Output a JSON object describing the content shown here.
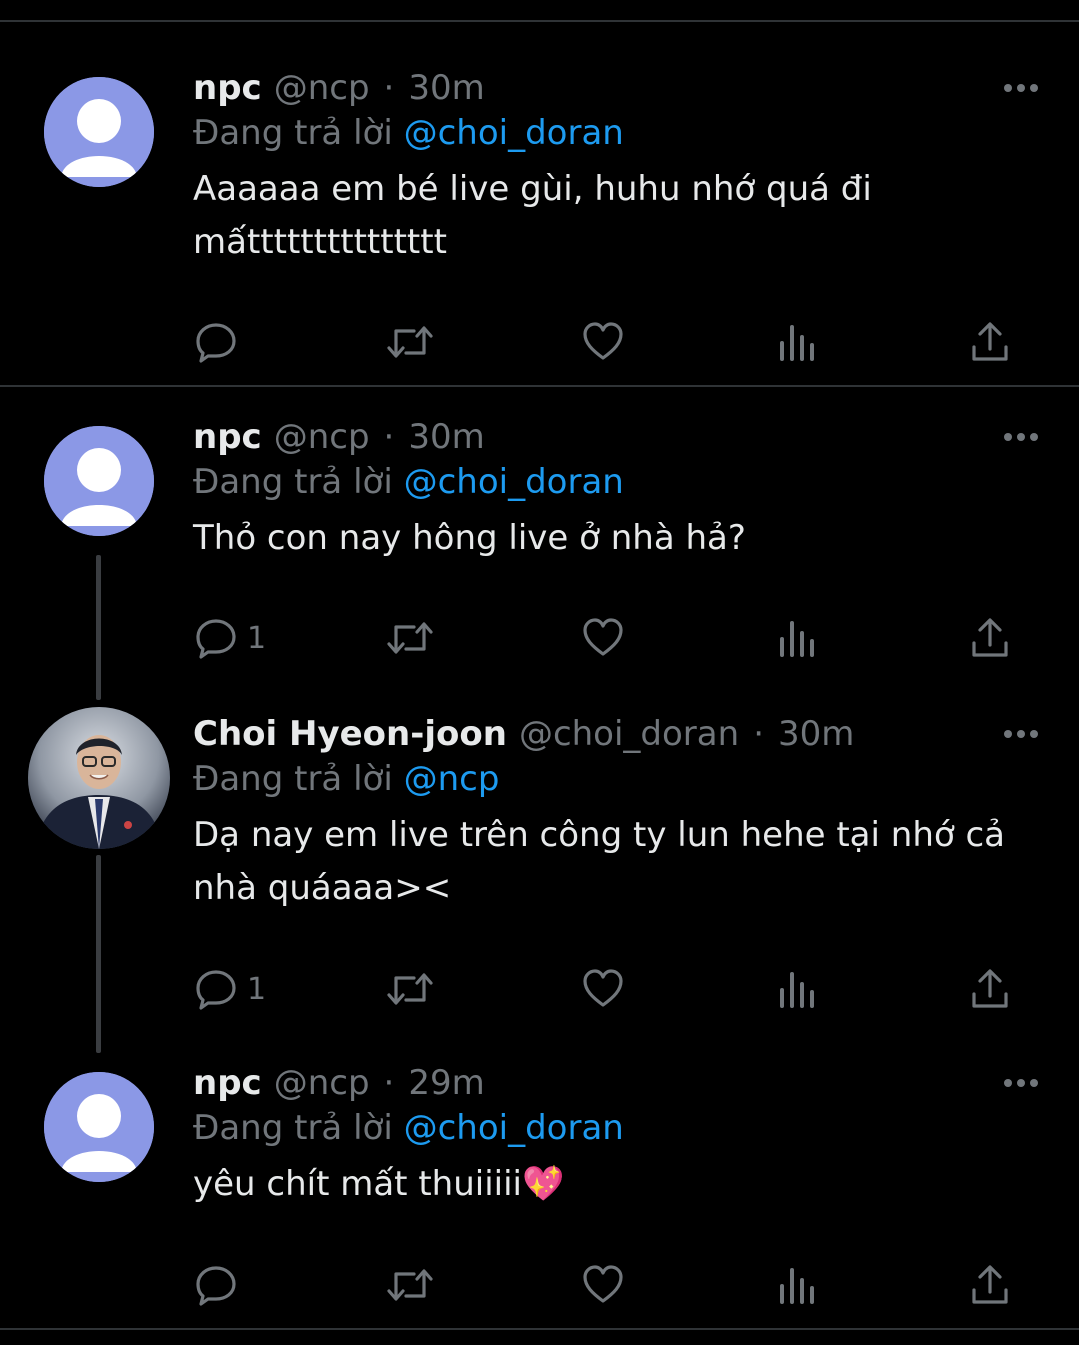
{
  "reply_prefix": "Đang trả lời",
  "tweets": [
    {
      "name": "npc",
      "handle": "@ncp",
      "time": "30m",
      "reply_to": "@choi_doran",
      "text": "Aaaaaa em bé live gùi, huhu nhớ quá đi mấttttttttttttttt",
      "reply_count": ""
    },
    {
      "name": "npc",
      "handle": "@ncp",
      "time": "30m",
      "reply_to": "@choi_doran",
      "text": "Thỏ con nay hông live ở nhà hả?",
      "reply_count": "1"
    },
    {
      "name": "Choi Hyeon-joon",
      "handle": "@choi_doran",
      "time": "30m",
      "reply_to": "@ncp",
      "text": "Dạ nay em live trên công ty lun hehe tại nhớ cả nhà quáaaa><",
      "reply_count": "1"
    },
    {
      "name": "npc",
      "handle": "@ncp",
      "time": "29m",
      "reply_to": "@choi_doran",
      "text": "yêu chít mất thuiiiii💖",
      "reply_count": ""
    }
  ],
  "colors": {
    "background": "#000000",
    "text_primary": "#e7e9ea",
    "text_secondary": "#71767b",
    "mention": "#1d9bf0",
    "divider": "#2f3336",
    "default_avatar": "#8b98e6"
  },
  "icons": [
    "more-icon",
    "reply-icon",
    "retweet-icon",
    "like-icon",
    "analytics-icon",
    "share-icon"
  ]
}
